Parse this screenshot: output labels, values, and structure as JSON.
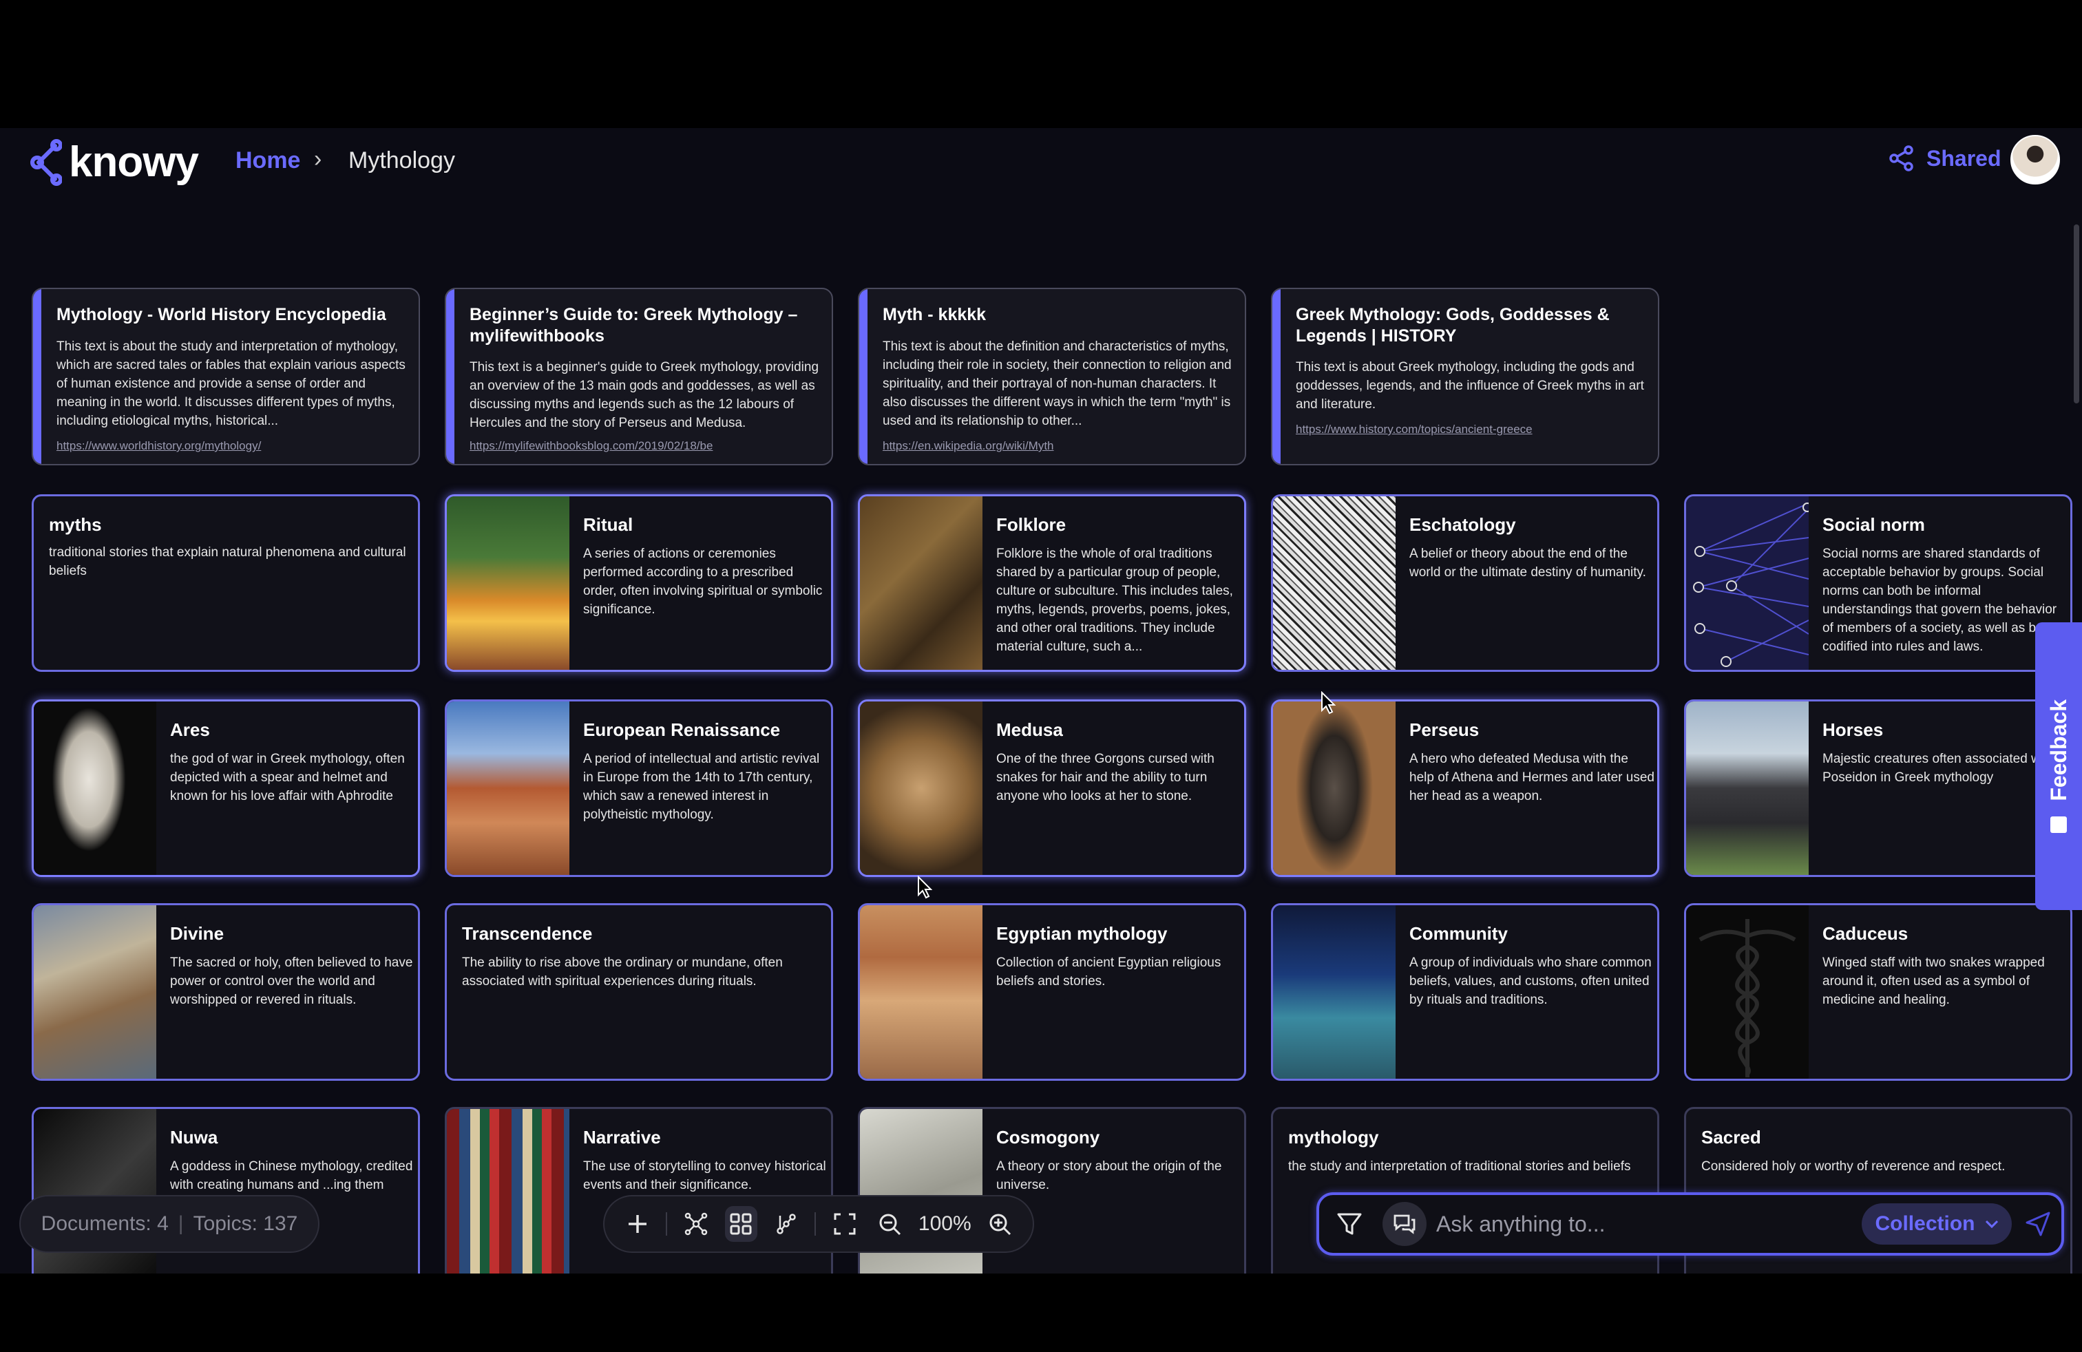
{
  "app": {
    "logo_text": "knowy"
  },
  "breadcrumb": {
    "home": "Home",
    "separator": "›",
    "current": "Mythology"
  },
  "header": {
    "shared_label": "Shared"
  },
  "feedback_label": "Feedback",
  "documents": [
    {
      "title": "Mythology - World History Encyclopedia",
      "body": "This text is about the study and interpretation of mythology, which are sacred tales or fables that explain various aspects of human existence and provide a sense of order and meaning in the world. It discusses different types of myths, including etiological myths, historical...",
      "link": "https://www.worldhistory.org/mythology/"
    },
    {
      "title": "Beginner’s Guide to: Greek Mythology – mylifewithbooks",
      "body": "This text is a beginner's guide to Greek mythology, providing an overview of the 13 main gods and goddesses, as well as discussing myths and legends such as the 12 labours of Hercules and the story of Perseus and Medusa.",
      "link": "https://mylifewithbooksblog.com/2019/02/18/be"
    },
    {
      "title": "Myth - kkkkk",
      "body": "This text is about the definition and characteristics of myths, including their role in society, their connection to religion and spirituality, and their portrayal of non-human characters. It also discusses the different ways in which the term \"myth\" is used and its relationship to other...",
      "link": "https://en.wikipedia.org/wiki/Myth"
    },
    {
      "title": "Greek Mythology: Gods, Goddesses & Legends | HISTORY",
      "body": "This text is about Greek mythology, including the gods and goddesses, legends, and the influence of Greek myths in art and literature.",
      "link": "https://www.history.com/topics/ancient-greece"
    }
  ],
  "topics": {
    "myths": {
      "title": "myths",
      "body": "traditional stories that explain natural phenomena and cultural beliefs"
    },
    "ritual": {
      "title": "Ritual",
      "body": "A series of actions or ceremonies performed according to a prescribed order, often involving spiritual or symbolic significance."
    },
    "folklore": {
      "title": "Folklore",
      "body": "Folklore is the whole of oral traditions shared by a particular group of people, culture or subculture. This includes tales, myths, legends, proverbs, poems, jokes, and other oral traditions. They include material culture, such a..."
    },
    "eschatology": {
      "title": "Eschatology",
      "body": "A belief or theory about the end of the world or the ultimate destiny of humanity."
    },
    "social_norm": {
      "title": "Social norm",
      "body": "Social norms are shared standards of acceptable behavior by groups. Social norms can both be informal understandings that govern the behavior of members of a society, as well as be codified into rules and laws."
    },
    "ares": {
      "title": "Ares",
      "body": "the god of war in Greek mythology, often depicted with a spear and helmet and known for his love affair with Aphrodite"
    },
    "renaissance": {
      "title": "European Renaissance",
      "body": "A period of intellectual and artistic revival in Europe from the 14th to 17th century, which saw a renewed interest in polytheistic mythology."
    },
    "medusa": {
      "title": "Medusa",
      "body": "One of the three Gorgons cursed with snakes for hair and the ability to turn anyone who looks at her to stone."
    },
    "perseus": {
      "title": "Perseus",
      "body": "A hero who defeated Medusa with the help of Athena and Hermes and later used her head as a weapon."
    },
    "horses": {
      "title": "Horses",
      "body": "Majestic creatures often associated with Poseidon in Greek mythology"
    },
    "divine": {
      "title": "Divine",
      "body": "The sacred or holy, often believed to have power or control over the world and worshipped or revered in rituals."
    },
    "transcendence": {
      "title": "Transcendence",
      "body": "The ability to rise above the ordinary or mundane, often associated with spiritual experiences during rituals."
    },
    "egyptian": {
      "title": "Egyptian mythology",
      "body": "Collection of ancient Egyptian religious beliefs and stories."
    },
    "community": {
      "title": "Community",
      "body": "A group of individuals who share common beliefs, values, and customs, often united by rituals and traditions."
    },
    "caduceus": {
      "title": "Caduceus",
      "body": "Winged staff with two snakes wrapped around it, often used as a symbol of medicine and healing."
    },
    "nuwa": {
      "title": "Nuwa",
      "body": "A goddess in Chinese mythology, credited with creating humans and ...ing them"
    },
    "narrative": {
      "title": "Narrative",
      "body": "The use of storytelling to convey historical events and their significance."
    },
    "cosmogony": {
      "title": "Cosmogony",
      "body": "A theory or story about the origin of the universe."
    },
    "mythology": {
      "title": "mythology",
      "body": "the study and interpretation of traditional stories and beliefs"
    },
    "sacred": {
      "title": "Sacred",
      "body": "Considered holy or worthy of reverence and respect."
    }
  },
  "stats": {
    "documents": "Documents: 4",
    "topics": "Topics: 137",
    "separator": "|"
  },
  "toolbar": {
    "zoom": "100%"
  },
  "chat": {
    "placeholder": "Ask anything to...",
    "collection_label": "Collection"
  },
  "colors": {
    "accent": "#6b6bff",
    "card_bg": "#111119",
    "app_bg": "#0b0b14"
  }
}
